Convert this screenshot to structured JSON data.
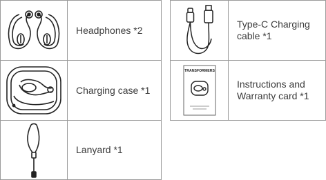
{
  "items": [
    {
      "label": "Headphones *2",
      "icon": "earbuds-icon"
    },
    {
      "label": "Charging case *1",
      "icon": "charging-case-icon"
    },
    {
      "label": "Lanyard *1",
      "icon": "lanyard-icon"
    },
    {
      "label": "Type-C Charging\ncable *1",
      "icon": "usb-c-cable-icon"
    },
    {
      "label": "Instructions and\nWarranty card *1",
      "icon": "manual-icon"
    }
  ],
  "manual_cover": {
    "title": "TRANSFORMERS"
  }
}
